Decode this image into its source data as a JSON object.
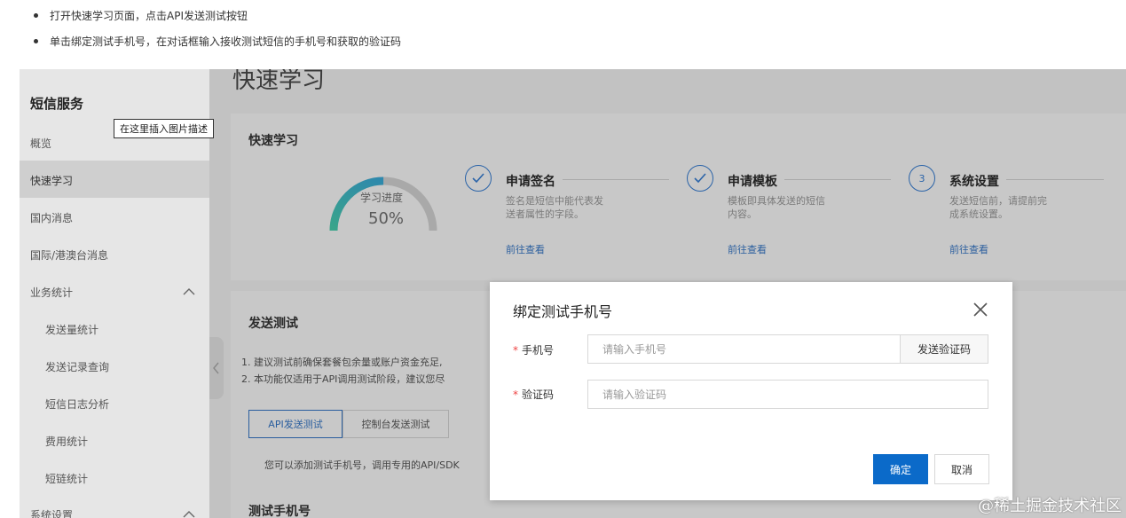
{
  "instructions": [
    "打开快速学习页面，点击API发送测试按钮",
    "单击绑定测试手机号，在对话框输入接收测试短信的手机号和获取的验证码"
  ],
  "sidebar": {
    "title": "短信服务",
    "items": [
      {
        "label": "概览"
      },
      {
        "label": "快速学习"
      },
      {
        "label": "国内消息"
      },
      {
        "label": "国际/港澳台消息"
      },
      {
        "label": "业务统计"
      },
      {
        "label": "发送量统计"
      },
      {
        "label": "发送记录查询"
      },
      {
        "label": "短信日志分析"
      },
      {
        "label": "费用统计"
      },
      {
        "label": "短链统计"
      },
      {
        "label": "系统设置"
      }
    ],
    "active_item": "快速学习"
  },
  "tooltip": "在这里插入图片描述",
  "main": {
    "page_title": "快速学习",
    "quick_learn": {
      "title": "快速学习",
      "progress_label": "学习进度",
      "progress_value": "50%",
      "progress_fraction": 0.5,
      "steps": [
        {
          "marker": "check",
          "title": "申请签名",
          "desc": "签名是短信中能代表发送者属性的字段。",
          "link": "前往查看"
        },
        {
          "marker": "check",
          "title": "申请模板",
          "desc": "模板即具体发送的短信内容。",
          "link": "前往查看"
        },
        {
          "marker": "3",
          "title": "系统设置",
          "desc": "发送短信前，请提前完成系统设置。",
          "link": "前往查看"
        }
      ]
    },
    "send_test": {
      "title": "发送测试",
      "notes": [
        "1. 建议测试前确保套餐包余量或账户资金充足,",
        "2. 本功能仅适用于API调用测试阶段，建议您尽"
      ],
      "tabs": [
        {
          "label": "API发送测试",
          "active": true
        },
        {
          "label": "控制台发送测试",
          "active": false
        }
      ],
      "hint": "您可以添加测试手机号，调用专用的API/SDK"
    },
    "test_phone_title": "测试手机号"
  },
  "modal": {
    "title": "绑定测试手机号",
    "phone": {
      "label": "手机号",
      "placeholder": "请输入手机号",
      "value": ""
    },
    "send_code_label": "发送验证码",
    "code": {
      "label": "验证码",
      "placeholder": "请输入验证码",
      "value": ""
    },
    "ok_label": "确定",
    "cancel_label": "取消"
  },
  "watermark": "@稀土掘金技术社区",
  "colors": {
    "accent": "#ff6a00",
    "primary": "#0b6ac9",
    "link": "#2a5e9e",
    "required": "#ee4444"
  }
}
